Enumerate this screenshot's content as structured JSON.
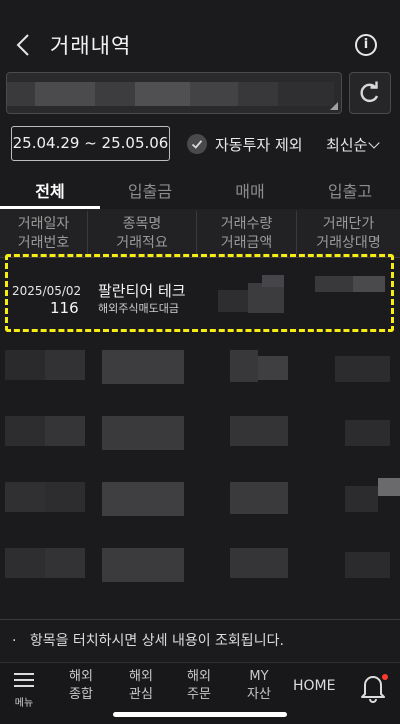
{
  "header": {
    "title": "거래내역",
    "info_glyph": "i"
  },
  "account": {
    "selector_icon": "dropdown-corner-icon",
    "refresh_icon": "refresh-icon"
  },
  "filter": {
    "date_range": "25.04.29 ~ 25.05.06",
    "exclude_auto_label": "자동투자 제외",
    "exclude_auto_checked": true,
    "sort_label": "최신순"
  },
  "tabs": [
    {
      "label": "전체",
      "active": true
    },
    {
      "label": "입출금",
      "active": false
    },
    {
      "label": "매매",
      "active": false
    },
    {
      "label": "입출고",
      "active": false
    }
  ],
  "table": {
    "headers": [
      {
        "top": "거래일자",
        "bottom": "거래번호"
      },
      {
        "top": "종목명",
        "bottom": "거래적요"
      },
      {
        "top": "거래수량",
        "bottom": "거래금액"
      },
      {
        "top": "거래단가",
        "bottom": "거래상대명"
      }
    ],
    "rows": [
      {
        "date": "2025/05/02",
        "number": "116",
        "name": "팔란티어 테크",
        "type": "해외주식매도대금"
      }
    ]
  },
  "notice": {
    "bullet": "·",
    "text": "항목을 터치하시면 상세 내용이 조회됩니다."
  },
  "bottom_nav": {
    "menu": "메뉴",
    "items": [
      {
        "line1": "해외",
        "line2": "종합"
      },
      {
        "line1": "해외",
        "line2": "관심"
      },
      {
        "line1": "해외",
        "line2": "주문"
      },
      {
        "line1": "MY",
        "line2": "자산"
      }
    ],
    "home": "HOME",
    "alert_color": "#ff3b30"
  },
  "colors": {
    "background": "#1b1b1d",
    "highlight": "#f7ec13"
  }
}
